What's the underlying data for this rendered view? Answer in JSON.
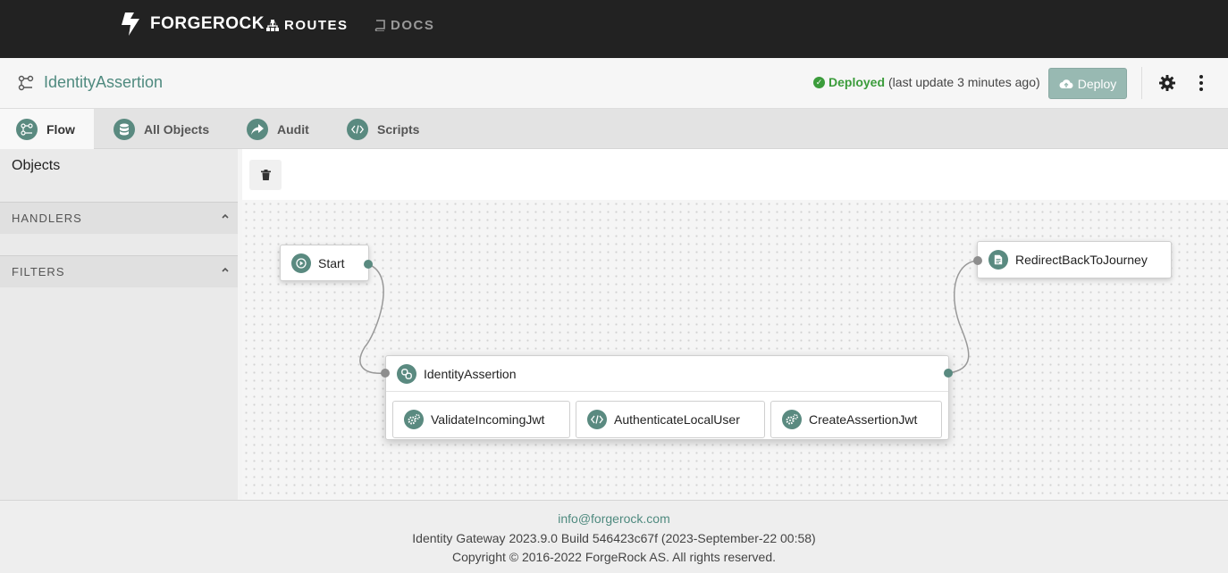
{
  "topnav": {
    "brand": "FORGEROCK",
    "brand_tm": "®",
    "routes_label": "ROUTES",
    "docs_label": "DOCS"
  },
  "header": {
    "title": "IdentityAssertion",
    "status_label": "Deployed",
    "status_note": "(last update 3 minutes ago)",
    "deploy_label": "Deploy"
  },
  "tabs": [
    {
      "label": "Flow",
      "icon": "flow-icon",
      "active": true
    },
    {
      "label": "All Objects",
      "icon": "database-icon",
      "active": false
    },
    {
      "label": "Audit",
      "icon": "share-icon",
      "active": false
    },
    {
      "label": "Scripts",
      "icon": "code-icon",
      "active": false
    }
  ],
  "panel": {
    "title": "Objects",
    "sections": [
      "HANDLERS",
      "FILTERS"
    ]
  },
  "flow": {
    "start": "Start",
    "redirect": "RedirectBackToJourney",
    "chain": "IdentityAssertion",
    "filters": [
      "ValidateIncomingJwt",
      "AuthenticateLocalUser",
      "CreateAssertionJwt"
    ]
  },
  "footer": {
    "email": "info@forgerock.com",
    "build": "Identity Gateway 2023.9.0 Build 546423c67f (2023-September-22 00:58)",
    "copyright": "Copyright © 2016-2022 ForgeRock AS. All rights reserved."
  },
  "colors": {
    "accent": "#5a8a80",
    "link": "#4f8a7f",
    "success": "#3b9c3b",
    "topbar": "#222222",
    "deploy_button": "#98b9b2"
  }
}
